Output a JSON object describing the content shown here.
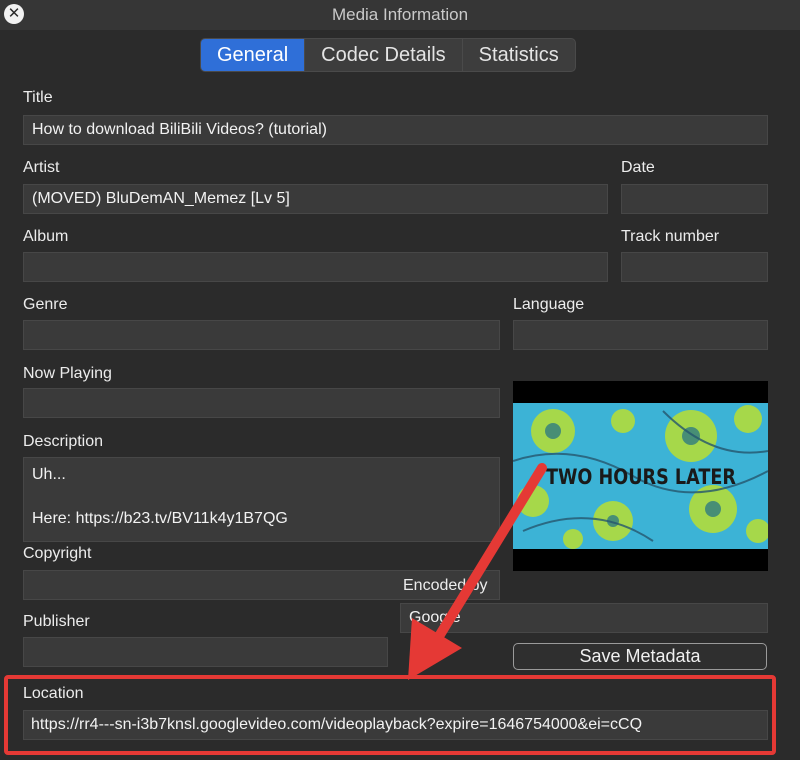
{
  "window": {
    "title": "Media Information",
    "close_glyph": "✕"
  },
  "tabs": [
    {
      "label": "General",
      "active": true
    },
    {
      "label": "Codec Details",
      "active": false
    },
    {
      "label": "Statistics",
      "active": false
    }
  ],
  "labels": {
    "title": "Title",
    "artist": "Artist",
    "date": "Date",
    "album": "Album",
    "track_number": "Track number",
    "genre": "Genre",
    "language": "Language",
    "now_playing": "Now Playing",
    "description": "Description",
    "copyright": "Copyright",
    "encoded_by": "Encoded by",
    "publisher": "Publisher",
    "location": "Location"
  },
  "values": {
    "title": "How to download BiliBili Videos? (tutorial)",
    "artist": "(MOVED) BluDemAN_Memez [Lv 5]",
    "date": "",
    "album": "",
    "track_number": "",
    "genre": "",
    "language": "",
    "now_playing": "",
    "description_lines": [
      "Uh...",
      "",
      "Here: https://b23.tv/BV11k4y1B7QG"
    ],
    "copyright": "",
    "encoded_by": "Google",
    "publisher": "",
    "location": "https://rr4---sn-i3b7knsl.googlevideo.com/videoplayback?expire=1646754000&ei=cCQ"
  },
  "artwork": {
    "caption": "TWO HOURS LATER"
  },
  "buttons": {
    "save_metadata": "Save Metadata"
  },
  "colors": {
    "accent_tab": "#2f6fd8",
    "annotation_red": "#e53935",
    "background": "#2b2b2b"
  }
}
